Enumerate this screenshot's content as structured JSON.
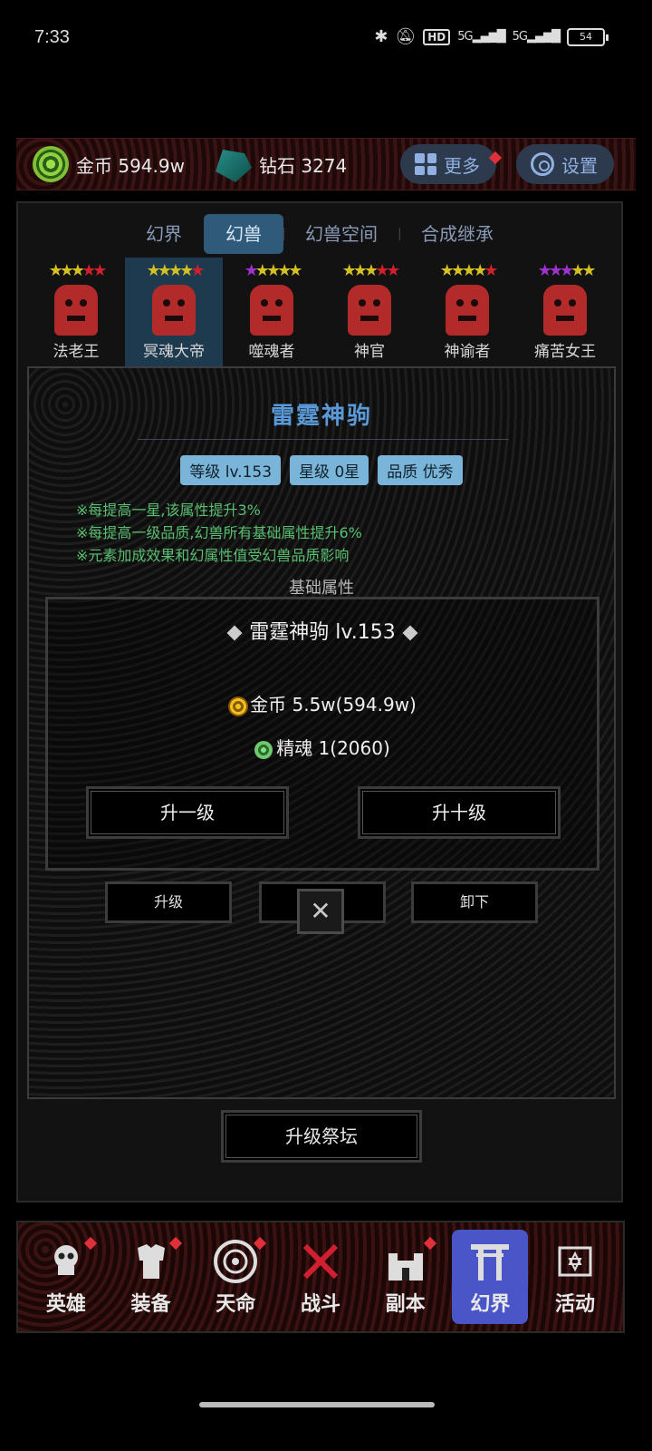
{
  "status": {
    "time": "7:33",
    "network_badge": "HD",
    "signal1": "5G",
    "signal2": "5G",
    "battery": "54"
  },
  "resources": {
    "gold_label": "金币 594.9w",
    "diamond_label": "钻石 3274"
  },
  "top_buttons": {
    "more": "更多",
    "settings": "设置"
  },
  "tabs": [
    "幻界",
    "幻兽",
    "幻兽空间",
    "合成继承"
  ],
  "beasts": [
    {
      "name": "法老王",
      "stars": [
        [
          "y",
          "★★★"
        ],
        [
          "r",
          "★★"
        ]
      ]
    },
    {
      "name": "冥魂大帝",
      "stars": [
        [
          "y",
          "★★★★"
        ],
        [
          "r",
          "★"
        ]
      ]
    },
    {
      "name": "噬魂者",
      "stars": [
        [
          "p",
          "★"
        ],
        [
          "y",
          "★★★★"
        ]
      ]
    },
    {
      "name": "神官",
      "stars": [
        [
          "y",
          "★★★"
        ],
        [
          "r",
          "★★"
        ]
      ]
    },
    {
      "name": "神谕者",
      "stars": [
        [
          "y",
          "★★★★"
        ],
        [
          "r",
          "★"
        ]
      ]
    },
    {
      "name": "痛苦女王",
      "stars": [
        [
          "p",
          "★★★"
        ],
        [
          "y",
          "★★"
        ]
      ]
    }
  ],
  "detail": {
    "title": "雷霆神驹",
    "level_badge": "等级 lv.153",
    "star_badge": "星级 0星",
    "quality_badge": "品质 优秀",
    "notes": [
      "※每提高一星,该属性提升3%",
      "※每提高一级品质,幻兽所有基础属性提升6%",
      "※元素加成效果和幻属性值受幻兽品质影响"
    ],
    "section_label": "基础属性",
    "upgrade_title": "雷霆神驹 lv.153",
    "cost_gold": "金币 5.5w(594.9w)",
    "cost_soul": "精魂 1(2060)",
    "btn_up1": "升一级",
    "btn_up10": "升十级",
    "btn_upgrade": "升级",
    "btn_close": "✕",
    "btn_unequip": "卸下",
    "btn_altar": "升级祭坛"
  },
  "nav": [
    {
      "label": "英雄",
      "icon": "skull-icon",
      "dot": true
    },
    {
      "label": "装备",
      "icon": "armor-icon",
      "dot": true
    },
    {
      "label": "天命",
      "icon": "medallion-icon",
      "dot": true
    },
    {
      "label": "战斗",
      "icon": "crossed-swords-icon",
      "dot": false
    },
    {
      "label": "副本",
      "icon": "castle-icon",
      "dot": true
    },
    {
      "label": "幻界",
      "icon": "torii-icon",
      "dot": false
    },
    {
      "label": "活动",
      "icon": "scroll-icon",
      "dot": false
    }
  ],
  "colors": {
    "tab_active": "#2f5a7a",
    "title_blue": "#5a9ad8",
    "note_green": "#58c070",
    "nav_active": "#4a56c8",
    "red_dot": "#e0303a"
  }
}
